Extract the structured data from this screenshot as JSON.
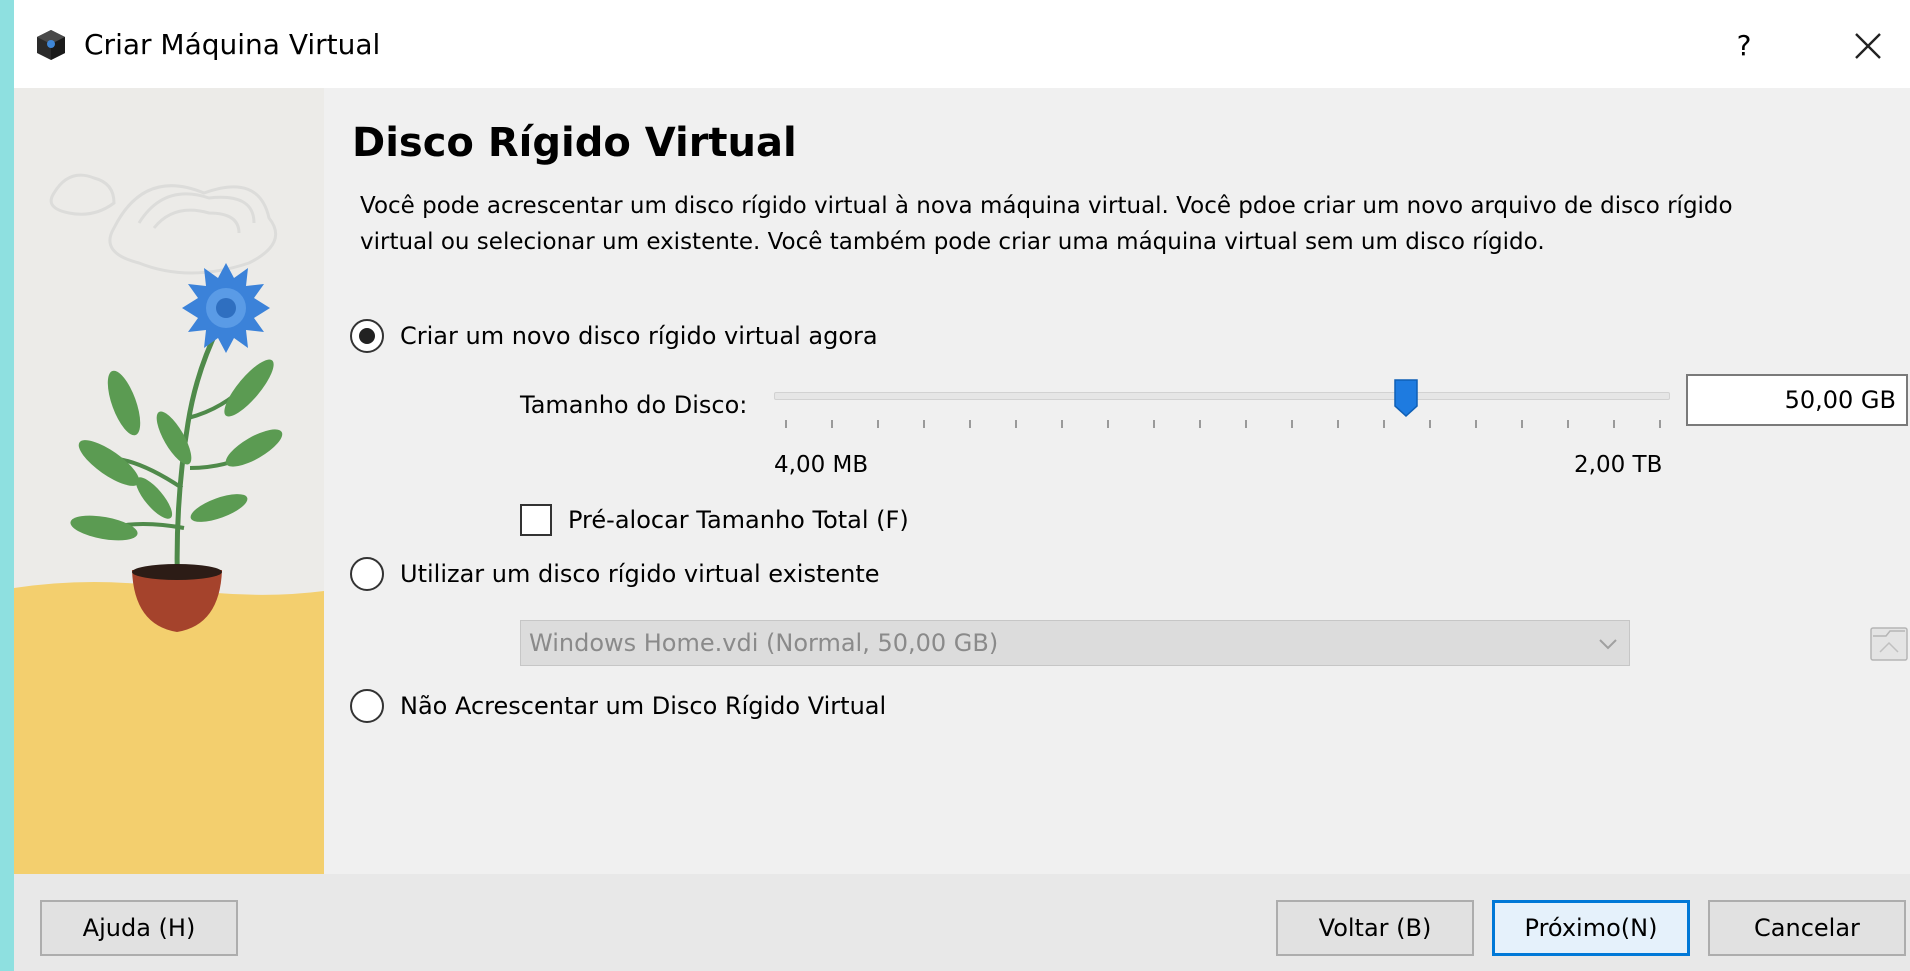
{
  "window": {
    "title": "Criar Máquina Virtual",
    "help_label": "?"
  },
  "page": {
    "heading": "Disco Rígido Virtual",
    "description": "Você pode acrescentar um disco rígido virtual à nova máquina virtual. Você pdoe criar um novo arquivo de disco rígido virtual ou selecionar um existente. Você também pode criar uma máquina virtual sem um disco rígido."
  },
  "options": {
    "create_new": {
      "label": "Criar um novo disco rígido virtual agora",
      "checked": true
    },
    "use_existing": {
      "label": "Utilizar um disco rígido virtual existente",
      "checked": false
    },
    "no_disk": {
      "label": "Não Acrescentar um Disco Rígido Virtual",
      "checked": false
    }
  },
  "disk_size": {
    "label": "Tamanho do Disco:",
    "value": "50,00 GB",
    "min_label": "4,00 MB",
    "max_label": "2,00 TB",
    "slider_fraction": 0.71,
    "tick_count": 20
  },
  "preallocate": {
    "label": "Pré-alocar Tamanho Total (F)",
    "checked": false
  },
  "existing_disk": {
    "selected": "Windows Home.vdi (Normal, 50,00 GB)"
  },
  "buttons": {
    "help": "Ajuda (H)",
    "back": "Voltar (B)",
    "next": "Próximo(N)",
    "cancel": "Cancelar"
  },
  "colors": {
    "accent": "#0078d7",
    "background": "#f0f0f0",
    "frame": "#8ee0e0"
  }
}
